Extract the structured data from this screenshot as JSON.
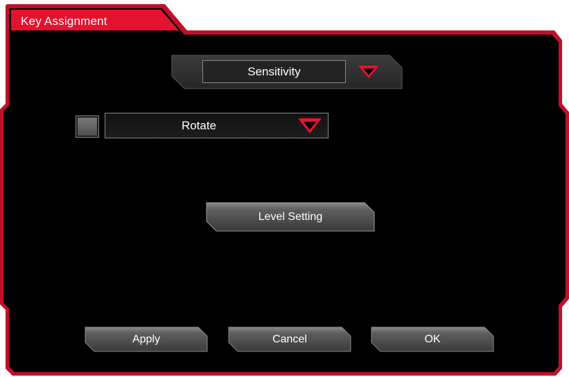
{
  "window": {
    "title": "Key Assignment"
  },
  "mode_select": {
    "value": "Sensitivity"
  },
  "rotate": {
    "checked": false,
    "select_value": "Rotate"
  },
  "buttons": {
    "level_setting": "Level Setting",
    "apply": "Apply",
    "cancel": "Cancel",
    "ok": "OK"
  },
  "icons": {
    "dropdown": "triangle-down-icon"
  },
  "colors": {
    "accent": "#e3132f",
    "background": "#000000",
    "button_fill": "#5a5a5a"
  }
}
